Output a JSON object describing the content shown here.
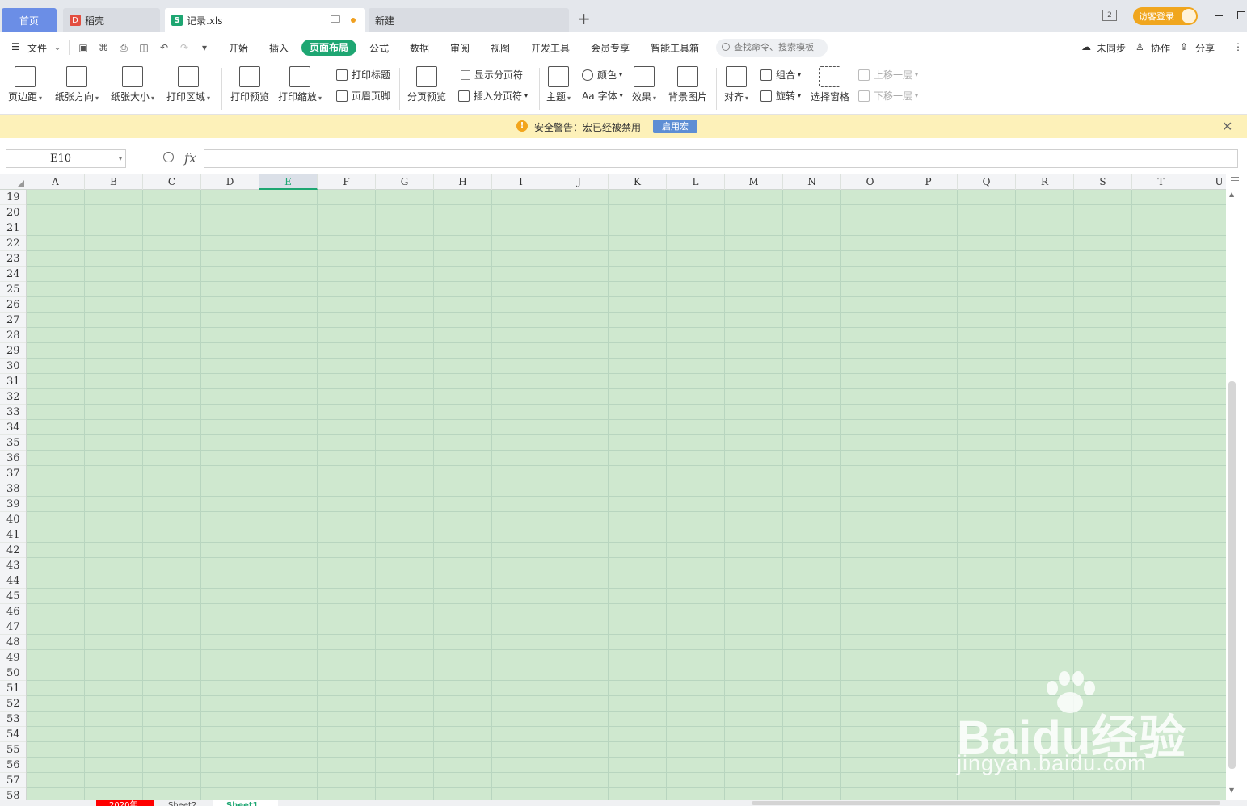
{
  "titlebar": {
    "tabs": [
      {
        "label": "首页"
      },
      {
        "label": "稻壳"
      },
      {
        "label": "记录.xls"
      },
      {
        "label": "新建"
      }
    ],
    "new_tab_symbol": "+",
    "window_count": "2",
    "login_label": "访客登录",
    "accent": "#1ea672"
  },
  "menu": {
    "file_label": "文件",
    "items": [
      "开始",
      "插入",
      "页面布局",
      "公式",
      "数据",
      "审阅",
      "视图",
      "开发工具",
      "会员专享",
      "智能工具箱"
    ],
    "active_index": 2,
    "search_placeholder": "查找命令、搜索模板",
    "sync_label": "未同步",
    "collab_label": "协作",
    "share_label": "分享"
  },
  "ribbon": {
    "margins": "页边距",
    "orientation": "纸张方向",
    "paper_size": "纸张大小",
    "print_area": "打印区域",
    "print_preview": "打印预览",
    "print_scale": "打印缩放",
    "print_titles": "打印标题",
    "header_footer": "页眉页脚",
    "page_break_preview": "分页预览",
    "show_page_breaks": "显示分页符",
    "insert_page_break": "插入分页符",
    "theme": "主题",
    "colors": "颜色",
    "fonts": "字体",
    "fonts_prefix": "Aa",
    "effects": "效果",
    "background": "背景图片",
    "align": "对齐",
    "group": "组合",
    "rotate": "旋转",
    "selection_pane": "选择窗格",
    "bring_forward": "上移一层",
    "send_backward": "下移一层"
  },
  "warning": {
    "text": "安全警告：宏已经被禁用",
    "button": "启用宏"
  },
  "formula": {
    "cell_ref": "E10",
    "fx": "fx",
    "value": ""
  },
  "grid": {
    "columns": [
      "A",
      "B",
      "C",
      "D",
      "E",
      "F",
      "G",
      "H",
      "I",
      "J",
      "K",
      "L",
      "M",
      "N",
      "O",
      "P",
      "Q",
      "R",
      "S",
      "T",
      "U"
    ],
    "selected_column": "E",
    "rows": [
      "19",
      "20",
      "21",
      "22",
      "23",
      "24",
      "25",
      "26",
      "27",
      "28",
      "29",
      "30",
      "31",
      "32",
      "33",
      "34",
      "35",
      "36",
      "37",
      "38",
      "39",
      "40",
      "41",
      "42",
      "43",
      "44",
      "45",
      "46",
      "47",
      "48",
      "49",
      "50",
      "51",
      "52",
      "53",
      "54",
      "55",
      "56",
      "57",
      "58"
    ],
    "cell_fill": "#cfe8cf"
  },
  "sheets": [
    {
      "label": "2020年"
    },
    {
      "label": "Sheet2"
    },
    {
      "label": "Sheet1"
    }
  ],
  "watermark": {
    "brand": "Bai",
    "brand_du": "du",
    "brand_cn": "经验",
    "url": "jingyan.baidu.com"
  }
}
